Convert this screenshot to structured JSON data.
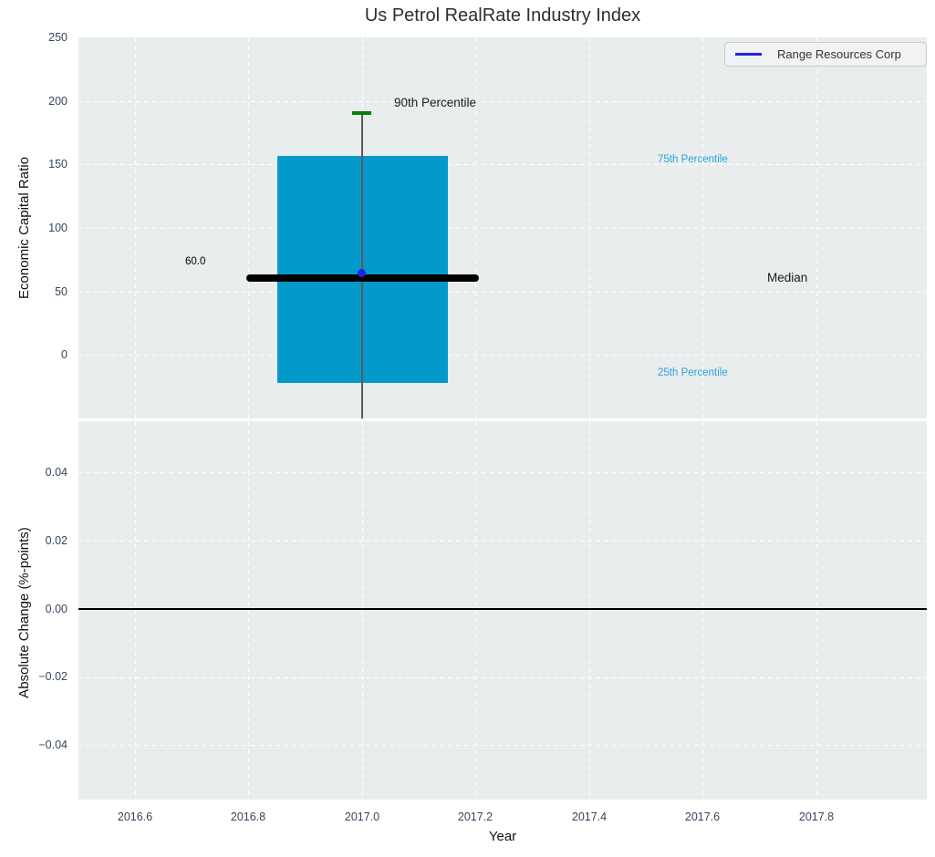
{
  "title": "Us Petrol RealRate Industry Index",
  "legend": {
    "label": "Range Resources Corp"
  },
  "annotations": {
    "median_value": "60.0",
    "p90_label": "90th Percentile",
    "p75_label": "75th Percentile",
    "median_label": "Median",
    "p25_label": "25th Percentile"
  },
  "axes": {
    "top": {
      "ylabel": "Economic Capital Ratio",
      "yticks": [
        "250",
        "200",
        "150",
        "100",
        "50",
        "0"
      ]
    },
    "bottom": {
      "ylabel": "Absolute Change (%-points)",
      "xlabel": "Year",
      "yticks": [
        "0.04",
        "0.02",
        "0.00",
        "−0.02",
        "−0.04"
      ],
      "xticks": [
        "2016.6",
        "2016.8",
        "2017.0",
        "2017.2",
        "2017.4",
        "2017.6",
        "2017.8"
      ]
    }
  },
  "colors": {
    "bar_fill": "#0499cb",
    "plot_background": "#e9edee",
    "gridline": "#ffffff",
    "percentile_label_blue": "#29a3db",
    "p90_cap_green": "#077d07",
    "median_line": "#000000",
    "company_marker_blue": "#2424e8",
    "tick_label": "#36455a"
  },
  "chart_data": [
    {
      "type": "box",
      "subplot": "top",
      "title": "Us Petrol RealRate Industry Index",
      "ylabel": "Economic Capital Ratio",
      "ylim": [
        -50,
        250
      ],
      "xlim": [
        2016.5,
        2018.0
      ],
      "yticks": [
        0,
        50,
        100,
        150,
        200,
        250
      ],
      "grid": true,
      "legend_position": "upper right",
      "industry_box": {
        "x": 2017.0,
        "p90": 190,
        "p75": 155,
        "median": 60,
        "p25": -20,
        "bar_x_span": [
          2016.85,
          2017.15
        ],
        "median_line_x_span": [
          2016.8,
          2017.2
        ],
        "whisker_top": 190,
        "whisker_bottom_clipped_at": -50
      },
      "series": [
        {
          "name": "Range Resources Corp",
          "marker": "point",
          "x": [
            2017.0
          ],
          "y": [
            63
          ]
        }
      ],
      "text_annotations": [
        {
          "text": "60.0",
          "x": 2016.69,
          "y": 68
        },
        {
          "text": "90th Percentile",
          "x": 2017.06,
          "y": 197
        },
        {
          "text": "75th Percentile",
          "x": 2017.52,
          "y": 152
        },
        {
          "text": "Median",
          "x": 2017.71,
          "y": 60
        },
        {
          "text": "25th Percentile",
          "x": 2017.52,
          "y": -15
        }
      ]
    },
    {
      "type": "line",
      "subplot": "bottom",
      "ylabel": "Absolute Change (%-points)",
      "xlabel": "Year",
      "ylim": [
        -0.057,
        0.055
      ],
      "xlim": [
        2016.5,
        2018.0
      ],
      "yticks": [
        -0.04,
        -0.02,
        0.0,
        0.02,
        0.04
      ],
      "xticks": [
        2016.6,
        2016.8,
        2017.0,
        2017.2,
        2017.4,
        2017.6,
        2017.8
      ],
      "grid": true,
      "zero_line_y": 0.0,
      "series": []
    }
  ]
}
